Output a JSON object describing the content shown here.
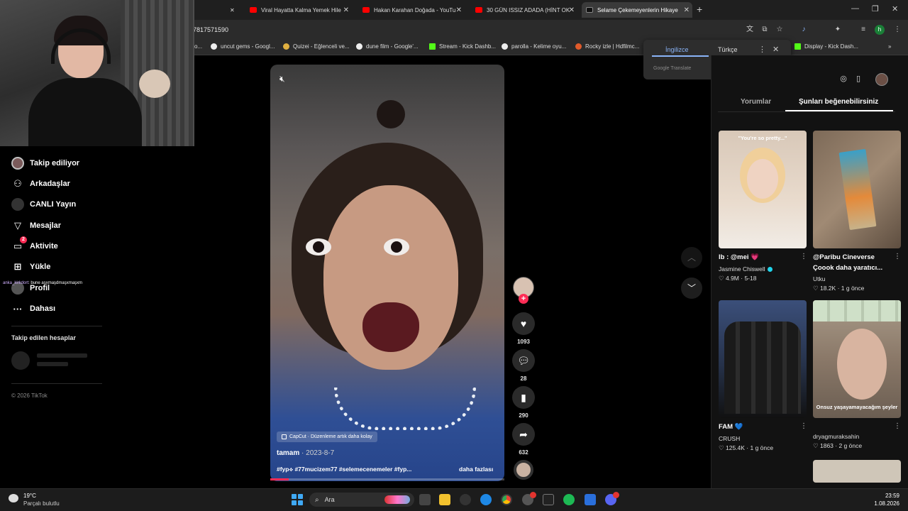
{
  "browser": {
    "tabs": [
      {
        "title": "Viral Hayatta Kalma Yemek Hile",
        "active": false
      },
      {
        "title": "Hakan Karahan Doğada - YouTu",
        "active": false
      },
      {
        "title": "30 GÜN ISSIZ ADADA (HİNT OK",
        "active": false
      },
      {
        "title": "Selame Çekemeyenlerin Hikaye",
        "active": true
      }
    ],
    "new_tab": "+",
    "url": "7817571590",
    "bookmarks": [
      "o...",
      "uncut gems - Googl...",
      "Quizei - Eğlenceli ve...",
      "dune film - Google'...",
      "Stream - Kick Dashb...",
      "parolla - Kelime oyu...",
      "Rocky izle | Hdfilmc...",
      "Display - Kick Dash..."
    ]
  },
  "translate_popup": {
    "tab_source": "İngilizce",
    "tab_target": "Türkçe",
    "brand": "Google Translate"
  },
  "sidebar": {
    "items": [
      {
        "label": "Takip ediliyor",
        "icon": "avatar-icon"
      },
      {
        "label": "Arkadaşlar",
        "icon": "friends-icon"
      },
      {
        "label": "CANLI Yayın",
        "icon": "live-icon"
      },
      {
        "label": "Mesajlar",
        "icon": "send-icon"
      },
      {
        "label": "Aktivite",
        "icon": "activity-icon",
        "badge": "2"
      },
      {
        "label": "Yükle",
        "icon": "upload-icon"
      },
      {
        "label": "Profil",
        "icon": "profile-icon"
      },
      {
        "label": "Dahası",
        "icon": "more-icon"
      }
    ],
    "followed_accounts_title": "Takip edilen hesaplar",
    "copyright": "© 2026 TikTok"
  },
  "chat_overlay": {
    "user": "anka_kirkdort",
    "message": ": bune aşxmaşdmaşxmaşxm"
  },
  "video": {
    "capcut_label": "CapCut · Düzenleme artık daha kolay",
    "author": "tamam",
    "date": " · 2023-8-7",
    "description": "#fyp⟡ #77mucizem77 #selemecenemeler #fyp...",
    "more": "daha fazlası",
    "progress": 0.08,
    "likes": "1093",
    "comments": "28",
    "saves": "290",
    "shares": "632"
  },
  "right_panel": {
    "tab_comments": "Yorumlar",
    "tab_suggestions": "Şunları beğenebilirsiniz",
    "cards": [
      {
        "caption": "\"You're so pretty...\"",
        "title": "lb : @mei 💗",
        "author": "Jasmine Chiswell",
        "verified": true,
        "likes": "4.9M",
        "date": "5-18",
        "bg": "#c9b8a8"
      },
      {
        "caption": "",
        "title": "@Paribu Cineverse",
        "title2": "Çoook daha yaratıcı...",
        "author": "Utku",
        "likes": "18.2K",
        "date": "1 g önce",
        "bg": "#7a6a5a"
      },
      {
        "caption": "",
        "title": "FAM 💙",
        "author": "CRUSH",
        "likes": "125.4K",
        "date": "1 g önce",
        "bg": "#2a3446"
      },
      {
        "caption": "Onsuz yaşayamayacağım şeyler",
        "title": "",
        "author": "dryagmuraksahin",
        "likes": "1863",
        "date": "2 g önce",
        "bg": "#8a7a6c"
      }
    ]
  },
  "taskbar": {
    "weather_temp": "19°C",
    "weather_desc": "Parçalı bulutlu",
    "search": "Ara",
    "time": "23:59",
    "date": "1.08.2026"
  },
  "colors": {
    "accent": "#fe2c55",
    "link_blue": "#8ab4f8"
  }
}
